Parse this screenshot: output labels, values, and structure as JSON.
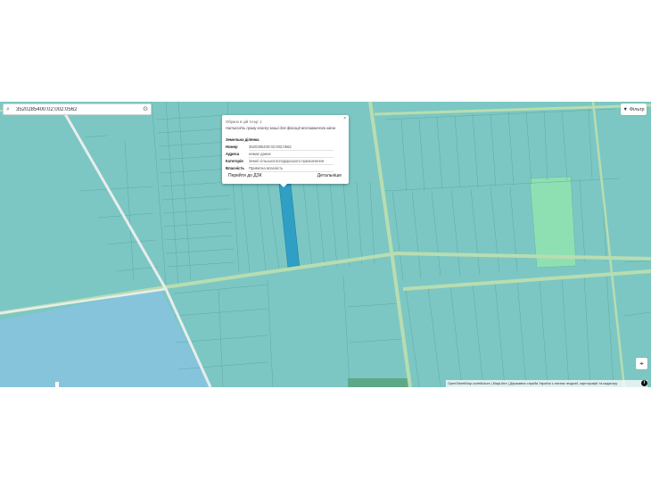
{
  "search": {
    "value": "3520285400:02:002:0562"
  },
  "filter": {
    "label": "Фільтр",
    "icon": "filter-icon"
  },
  "popup": {
    "selected": "Обрано в цій точці: 1",
    "hint": "Натисніть праву кнопку миші для фіксації вспливаючого вікна",
    "section": "Земельна ділянка",
    "rows": [
      {
        "key": "Номер",
        "value": "3520285400:02:002:0562"
      },
      {
        "key": "Адреса",
        "value": "немає даних"
      },
      {
        "key": "Категорія",
        "value": "Землі сільськогосподарського призначення"
      },
      {
        "key": "Власність",
        "value": "Приватна власність"
      }
    ],
    "goto_label": "Перейти до ДЗК",
    "details_label": "Детальніше",
    "close_symbol": "×"
  },
  "attribution": "OpenStreetMap contributors | MapLibre | Державна служба України з питань геодезії, картографії та кадастру",
  "colors": {
    "parcel": "#7cc7c3",
    "road": "#b8ddb0",
    "selected_parcel": "#2f9fc4",
    "highlight_parcel": "#8ee0b2",
    "water": "#86c4dc"
  }
}
